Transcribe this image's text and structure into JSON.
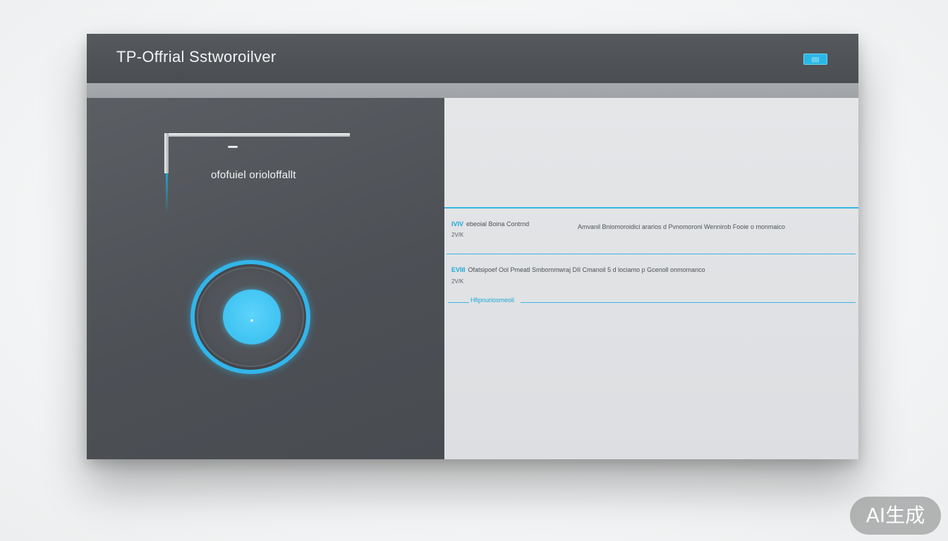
{
  "window": {
    "title": "TP-Offrial Sstworoilver",
    "title_badge": "|||||"
  },
  "left_pane": {
    "label": "ofofuiel orioloffallt",
    "dial": {
      "accent": "#33b5ea",
      "core_color": "#44c8f5"
    }
  },
  "right_pane": {
    "rows": [
      {
        "tag": "IVIV",
        "title": "ebeoial Boina Contrnd",
        "value": "2V/K",
        "description": "Amvanil Bniomoroidici ararios d Pvnomoroni Wennirob Fooie o monmaico"
      },
      {
        "tag": "EVIII",
        "title": "Ofatsipoef Ool Pmeatl Smbommwraj DII Cmanoil 5 d lociamo p Gcenoll onmomanco",
        "value": "2V/K",
        "description": ""
      }
    ],
    "link": "Hfipnuriosmeoli"
  },
  "colors": {
    "accent": "#38b6e3",
    "titlebar": "#4e5155",
    "left_pane": "#53575c",
    "right_pane": "#e0e2e5"
  },
  "watermark": "AI生成"
}
